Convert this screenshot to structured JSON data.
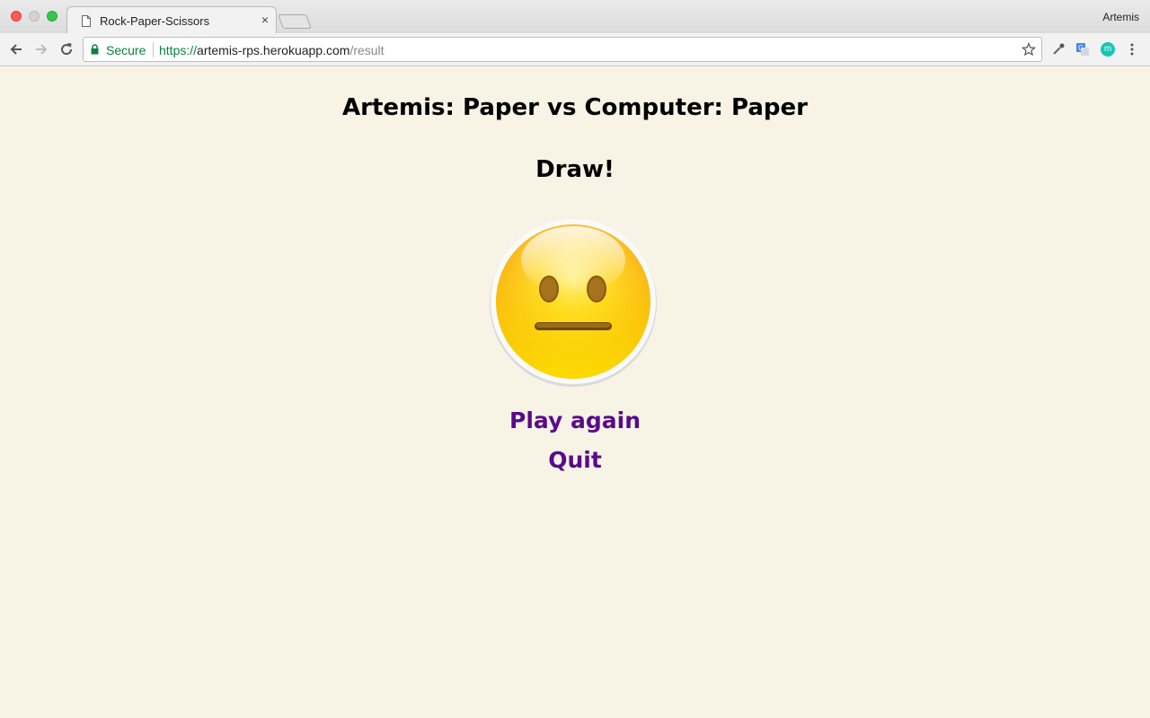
{
  "browser": {
    "tab_title": "Rock-Paper-Scissors",
    "tab_close": "×",
    "profile_name": "Artemis",
    "secure_label": "Secure",
    "url_scheme": "https://",
    "url_host": "artemis-rps.herokuapp.com",
    "url_path": "/result",
    "extension_m_label": "m"
  },
  "result": {
    "matchup": "Artemis: Paper vs Computer: Paper",
    "outcome": "Draw!",
    "emoji": "neutral-face"
  },
  "actions": {
    "play_again": "Play again",
    "quit": "Quit"
  },
  "colors": {
    "page_background": "#f7f4e6",
    "link": "#5a0a8c",
    "secure_green": "#0b8043"
  }
}
